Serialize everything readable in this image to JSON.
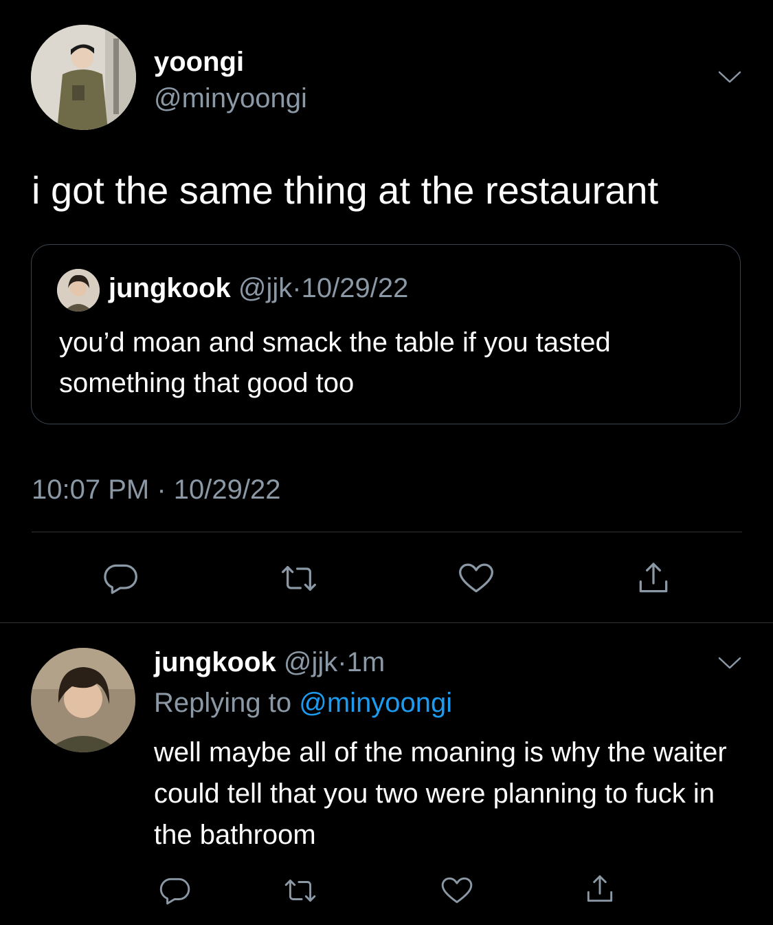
{
  "main_tweet": {
    "name": "yoongi",
    "handle": "@minyoongi",
    "text": "i got the same thing at the restaurant",
    "timestamp": "10:07 PM · 10/29/22",
    "quoted": {
      "name": "jungkook",
      "handle": "@jjk",
      "separator": "·",
      "date": "10/29/22",
      "text": "you’d moan and smack the table if you tasted something that good too"
    }
  },
  "reply": {
    "name": "jungkook",
    "handle": "@jjk",
    "separator": "·",
    "time": "1m",
    "replying_prefix": "Replying to",
    "replying_to": "@minyoongi",
    "text": "well maybe all of the moaning is why the waiter could tell that you two were planning to fuck in the bathroom"
  },
  "actions": [
    "reply-icon",
    "retweet-icon",
    "like-icon",
    "share-icon"
  ],
  "colors": {
    "background": "#000000",
    "primary_text": "#ffffff",
    "secondary_text": "#8b98a5",
    "accent": "#1d9bf0",
    "border": "#2f3336"
  }
}
